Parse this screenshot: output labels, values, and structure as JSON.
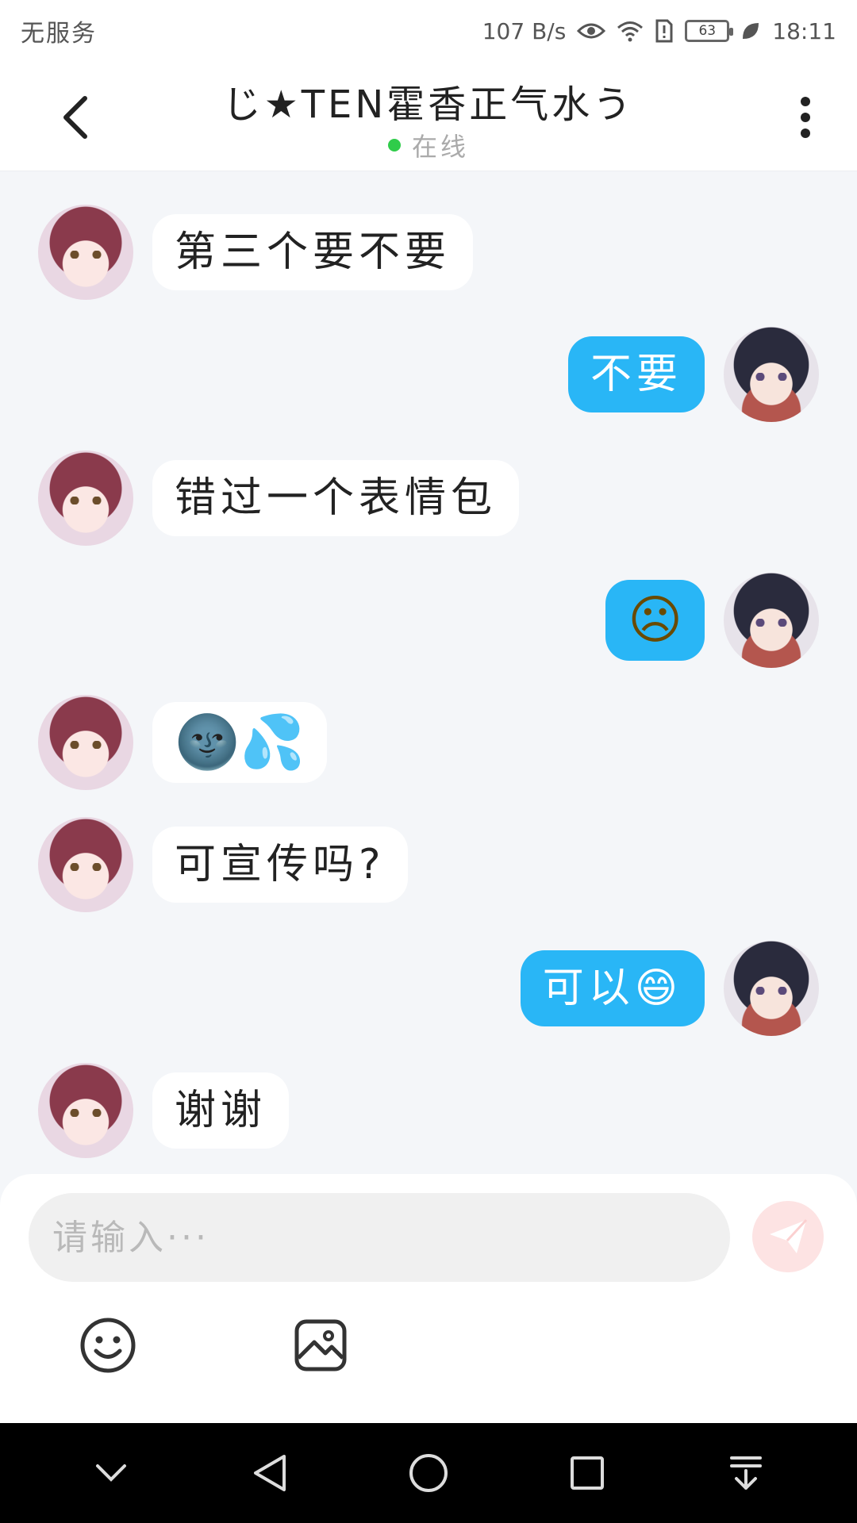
{
  "status_bar": {
    "carrier": "无服务",
    "speed": "107 B/s",
    "battery": "63",
    "time": "18:11"
  },
  "header": {
    "title": "じ★TEN霍香正气水う",
    "online_status": "在线",
    "online_color": "#2fcc4a"
  },
  "messages": [
    {
      "side": "left",
      "text": "第三个要不要"
    },
    {
      "side": "right",
      "text": "不要"
    },
    {
      "side": "left",
      "text": "错过一个表情包"
    },
    {
      "side": "right",
      "text": "☹"
    },
    {
      "side": "left",
      "text": "🌚💦"
    },
    {
      "side": "left",
      "text": "可宣传吗?"
    },
    {
      "side": "right",
      "text": "可以😄"
    },
    {
      "side": "left",
      "text": "谢谢"
    }
  ],
  "input": {
    "placeholder": "请输入···"
  },
  "colors": {
    "sent_bubble": "#29b6f6",
    "received_bubble": "#ffffff",
    "background": "#f4f6f9"
  },
  "icons": {
    "back": "chevron-left-icon",
    "more": "more-vertical-icon",
    "send": "send-icon",
    "emoji": "emoji-icon",
    "image": "image-icon"
  }
}
